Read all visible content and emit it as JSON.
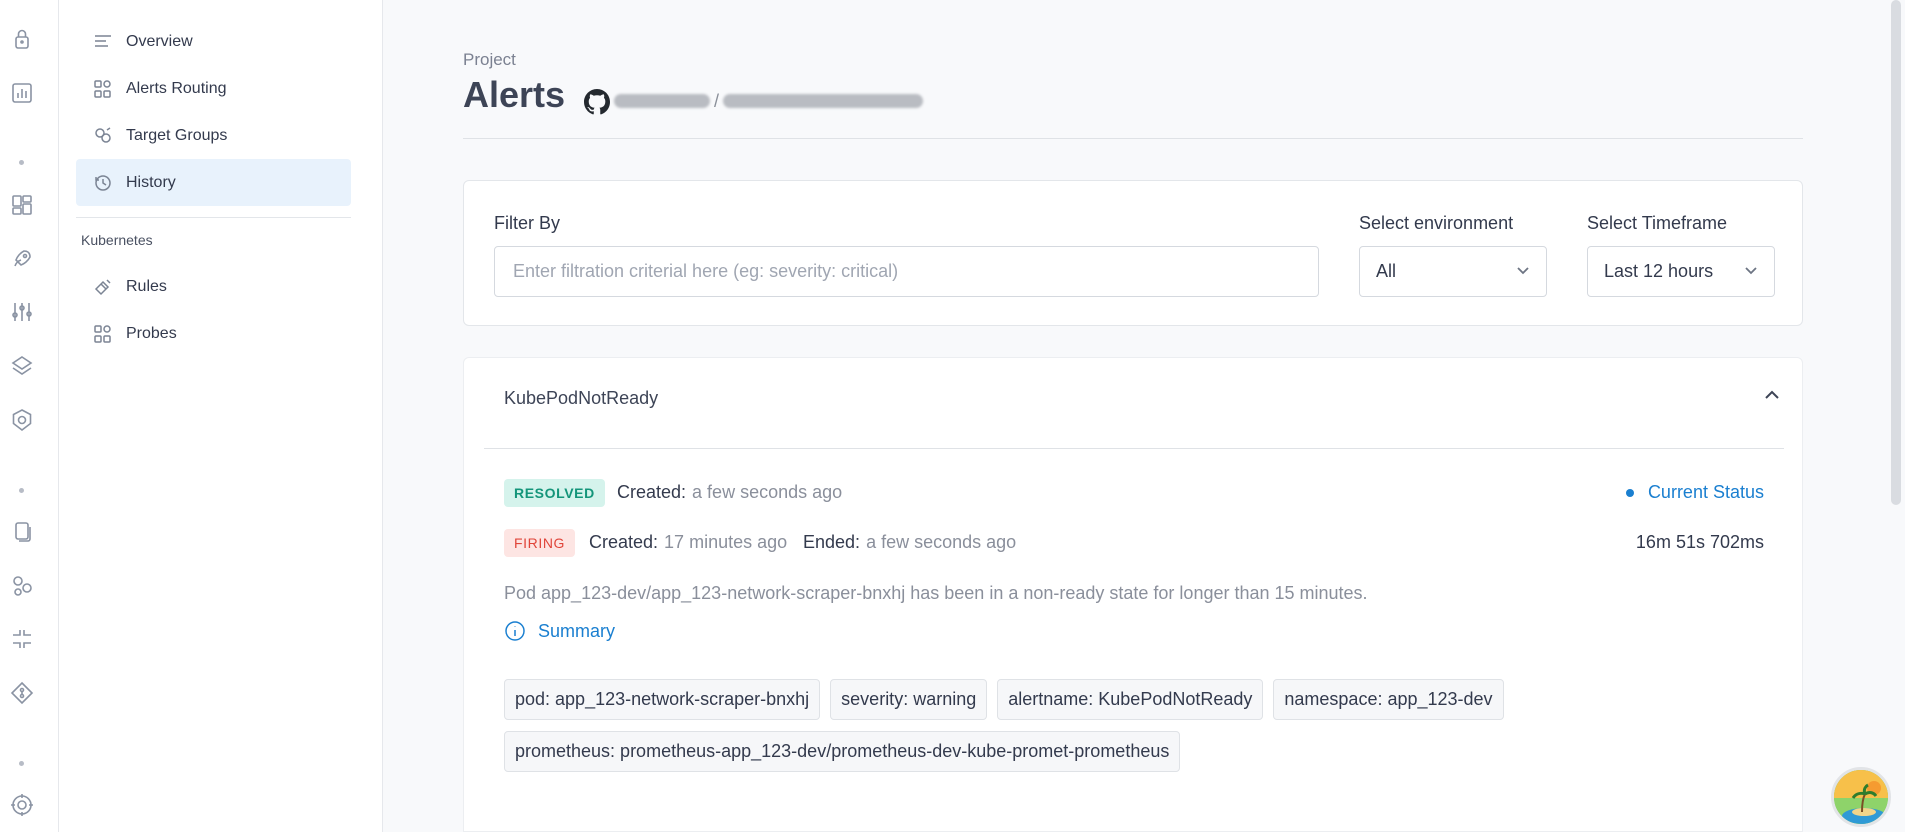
{
  "rail": {
    "icons": [
      "lock-icon",
      "chart-icon",
      "dashboard-icon",
      "rocket-icon",
      "sliders-icon",
      "layers-icon",
      "helm-icon",
      "documents-icon",
      "services-icon",
      "plugin-icon",
      "git-icon",
      "target-icon"
    ]
  },
  "sidenav": {
    "items": [
      {
        "label": "Overview",
        "icon": "overview-icon"
      },
      {
        "label": "Alerts Routing",
        "icon": "routing-icon"
      },
      {
        "label": "Target Groups",
        "icon": "target-groups-icon"
      },
      {
        "label": "History",
        "icon": "history-icon",
        "active": true
      }
    ],
    "section_label": "Kubernetes",
    "k8s_items": [
      {
        "label": "Rules",
        "icon": "rules-icon"
      },
      {
        "label": "Probes",
        "icon": "probes-icon"
      }
    ]
  },
  "header": {
    "eyebrow": "Project",
    "title": "Alerts",
    "repo_separator": "/"
  },
  "filter": {
    "label": "Filter By",
    "placeholder": "Enter filtration criterial here (eg: severity: critical)",
    "value": "",
    "env_label": "Select environment",
    "env_value": "All",
    "timeframe_label": "Select Timeframe",
    "timeframe_value": "Last 12 hours"
  },
  "alert": {
    "name": "KubePodNotReady",
    "resolved": {
      "badge": "RESOLVED",
      "created_label": "Created:",
      "created_value": "a few seconds ago"
    },
    "firing": {
      "badge": "FIRING",
      "created_label": "Created:",
      "created_value": "17 minutes ago",
      "ended_label": "Ended:",
      "ended_value": "a few seconds ago"
    },
    "current_status": "Current Status",
    "duration": "16m 51s 702ms",
    "description": "Pod app_123-dev/app_123-network-scraper-bnxhj has been in a non-ready state for longer than 15 minutes.",
    "summary_label": "Summary",
    "tags": [
      "pod: app_123-network-scraper-bnxhj",
      "severity: warning",
      "alertname: KubePodNotReady",
      "namespace: app_123-dev",
      "prometheus: prometheus-app_123-dev/prometheus-dev-kube-promet-prometheus"
    ]
  },
  "colors": {
    "accent": "#1a7fd0",
    "resolved": "#14957a",
    "firing": "#e0453a",
    "active_nav_bg": "#e8f2fc"
  }
}
